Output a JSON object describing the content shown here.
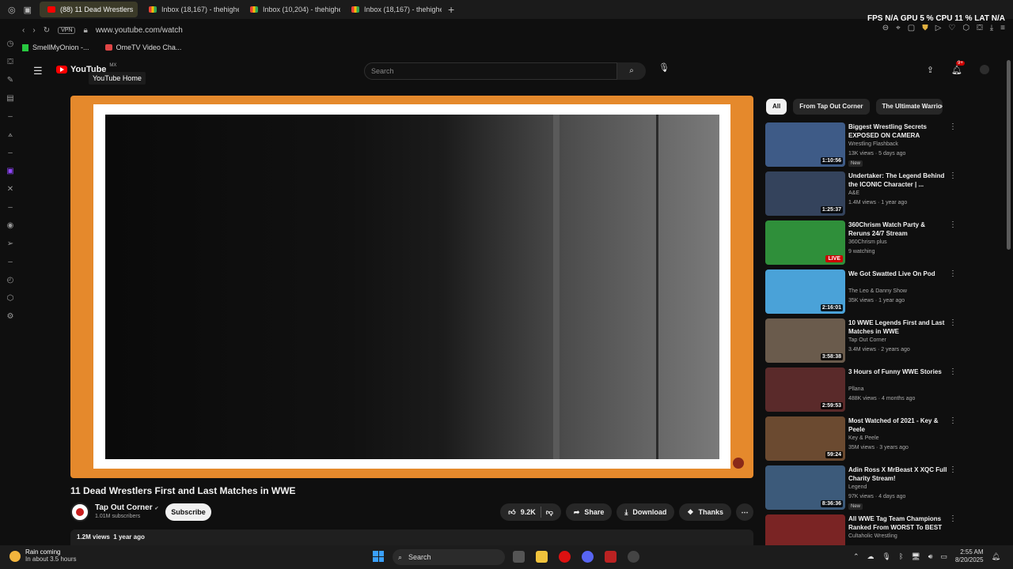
{
  "browser": {
    "tabs": [
      {
        "label": "(88) 11 Dead Wrestlers",
        "icon": "youtube-icon",
        "active": true
      },
      {
        "label": "Inbox (18,167) - thehighe",
        "icon": "gmail-icon"
      },
      {
        "label": "Inbox (10,204) - thehighe",
        "icon": "gmail-icon"
      },
      {
        "label": "Inbox (18,167) - thehighe",
        "icon": "gmail-icon"
      }
    ],
    "new_tab_label": "+",
    "vpn_label": "VPN",
    "url": "www.youtube.com/watch",
    "bookmarks": [
      "SmellMyOnion -...",
      "OmeTV Video Cha..."
    ],
    "hud": {
      "fps_label": "FPS",
      "fps_value": "N/A",
      "gpu_label": "GPU",
      "gpu_value": "5 %",
      "cpu_label": "CPU",
      "cpu_value": "11 %",
      "lat_label": "LAT",
      "lat_value": "N/A"
    }
  },
  "youtube": {
    "logo_text": "YouTube",
    "country_code": "MX",
    "tooltip": "YouTube Home",
    "search_placeholder": "Search",
    "notification_count": "9+",
    "video": {
      "title": "11 Dead Wrestlers First and Last Matches in WWE",
      "channel": "Tap Out Corner",
      "subscribers": "1.01M subscribers",
      "subscribe_label": "Subscribe",
      "likes": "9.2K",
      "share_label": "Share",
      "download_label": "Download",
      "thanks_label": "Thanks",
      "views": "1.2M views",
      "age": "1 year ago"
    },
    "chips": [
      "All",
      "From Tap Out Corner",
      "The Ultimate Warrio"
    ],
    "recommendations": [
      {
        "title": "Biggest Wrestling Secrets EXPOSED ON CAMERA",
        "channel": "Wrestling Flashback",
        "meta": "13K views · 5 days ago",
        "badge": "New",
        "duration": "1:10:56",
        "thumb_color": "#3e5b87"
      },
      {
        "title": "Undertaker: The Legend Behind the ICONIC Character | ...",
        "channel": "A&E",
        "meta": "1.4M views · 1 year ago",
        "duration": "1:25:37",
        "thumb_color": "#34435c"
      },
      {
        "title": "360Chrism Watch Party & Reruns 24/7 Stream",
        "channel": "360Chrism plus",
        "meta": "9 watching",
        "live": "LIVE",
        "thumb_color": "#2f8f3a"
      },
      {
        "title": "We Got Swatted Live On Pod",
        "channel": "The Leo & Danny Show",
        "meta": "35K views · 1 year ago",
        "duration": "2:16:01",
        "thumb_color": "#4aa2d8"
      },
      {
        "title": "10 WWE Legends First and Last Matches in WWE",
        "channel": "Tap Out Corner",
        "meta": "3.4M views · 2 years ago",
        "duration": "3:58:38",
        "thumb_color": "#6a5b4c"
      },
      {
        "title": "3 Hours of Funny WWE Stories",
        "channel": "Pllana",
        "meta": "488K views · 4 months ago",
        "duration": "2:59:53",
        "thumb_color": "#5a2a2a"
      },
      {
        "title": "Most Watched of 2021 - Key & Peele",
        "channel": "Key & Peele",
        "meta": "35M views · 3 years ago",
        "duration": "59:24",
        "thumb_color": "#6b4a30"
      },
      {
        "title": "Adin Ross X MrBeast X XQC Full Charity Stream!",
        "channel": "Legend",
        "meta": "97K views · 4 days ago",
        "badge": "New",
        "duration": "8:36:36",
        "thumb_color": "#3c5a7a"
      },
      {
        "title": "All WWE Tag Team Champions Ranked From WORST To BEST",
        "channel": "Cultaholic Wrestling",
        "meta": "",
        "thumb_color": "#7a2424"
      }
    ]
  },
  "taskbar": {
    "weather_title": "Rain coming",
    "weather_sub": "In about 3.5 hours",
    "search_label": "Search",
    "time": "2:55 AM",
    "date": "8/20/2025"
  },
  "colors": {
    "accent": "#ff0000",
    "player_border": "#e5892c"
  }
}
